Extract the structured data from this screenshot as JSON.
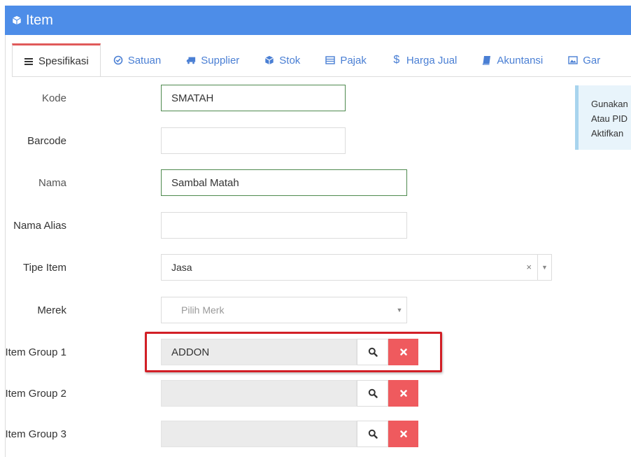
{
  "header": {
    "title": "Item"
  },
  "tabs": [
    {
      "label": "Spesifikasi",
      "icon": "list-icon",
      "active": true
    },
    {
      "label": "Satuan",
      "icon": "check-circle-icon"
    },
    {
      "label": "Supplier",
      "icon": "truck-icon"
    },
    {
      "label": "Stok",
      "icon": "cube-icon"
    },
    {
      "label": "Pajak",
      "icon": "table-icon"
    },
    {
      "label": "Harga Jual",
      "icon": "dollar-icon"
    },
    {
      "label": "Akuntansi",
      "icon": "book-icon"
    },
    {
      "label": "Gar",
      "icon": "image-icon"
    }
  ],
  "form": {
    "kode": {
      "label": "Kode",
      "value": "SMATAH"
    },
    "barcode": {
      "label": "Barcode",
      "value": ""
    },
    "nama": {
      "label": "Nama",
      "value": "Sambal Matah"
    },
    "nama_alias": {
      "label": "Nama Alias",
      "value": ""
    },
    "tipe_item": {
      "label": "Tipe Item",
      "value": "Jasa",
      "clear": "×"
    },
    "merek": {
      "label": "Merek",
      "placeholder": "Pilih Merk"
    },
    "item_group_1": {
      "label": "Item Group 1",
      "value": "ADDON"
    },
    "item_group_2": {
      "label": "Item Group 2",
      "value": ""
    },
    "item_group_3": {
      "label": "Item Group 3",
      "value": ""
    }
  },
  "info": {
    "lines": [
      "Gunakan",
      "Atau PID",
      "Aktifkan"
    ]
  },
  "colors": {
    "header": "#4d8de8",
    "tab_link": "#4a7fd4",
    "active_tab_top": "#e05a5a",
    "clear_button": "#ef5a5e",
    "highlight": "#d21f26",
    "valid_border": "#4f8a4f"
  }
}
